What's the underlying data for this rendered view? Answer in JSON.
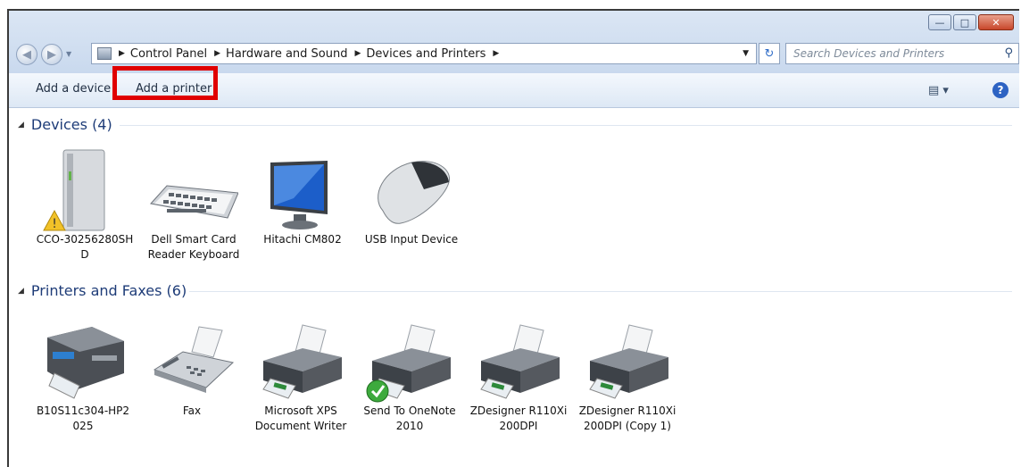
{
  "window": {
    "buttons": [
      "minimize",
      "maximize",
      "close"
    ]
  },
  "address_bar": {
    "crumbs": [
      "Control Panel",
      "Hardware and Sound",
      "Devices and Printers"
    ],
    "search_placeholder": "Search Devices and Printers"
  },
  "toolbar": {
    "add_device": "Add a device",
    "add_printer": "Add a printer"
  },
  "groups": {
    "devices": {
      "title": "Devices (4)",
      "items": [
        {
          "label": "CCO-30256280SH D",
          "icon": "external-drive-warning-icon"
        },
        {
          "label": "Dell Smart Card Reader Keyboard",
          "icon": "keyboard-icon"
        },
        {
          "label": "Hitachi CM802",
          "icon": "monitor-icon"
        },
        {
          "label": "USB Input Device",
          "icon": "mouse-icon"
        }
      ]
    },
    "printers": {
      "title": "Printers and Faxes (6)",
      "items": [
        {
          "label": "B10S11c304-HP2 025",
          "icon": "multifunction-printer-icon"
        },
        {
          "label": "Fax",
          "icon": "fax-icon"
        },
        {
          "label": "Microsoft XPS Document Writer",
          "icon": "printer-icon"
        },
        {
          "label": "Send To OneNote 2010",
          "icon": "printer-default-icon"
        },
        {
          "label": "ZDesigner R110Xi 200DPI",
          "icon": "printer-icon"
        },
        {
          "label": "ZDesigner R110Xi 200DPI (Copy 1)",
          "icon": "printer-icon"
        }
      ]
    }
  },
  "colors": {
    "highlight": "#e00000",
    "group_header": "#1e3c78",
    "toolbar_bg": "#dde8f5"
  }
}
